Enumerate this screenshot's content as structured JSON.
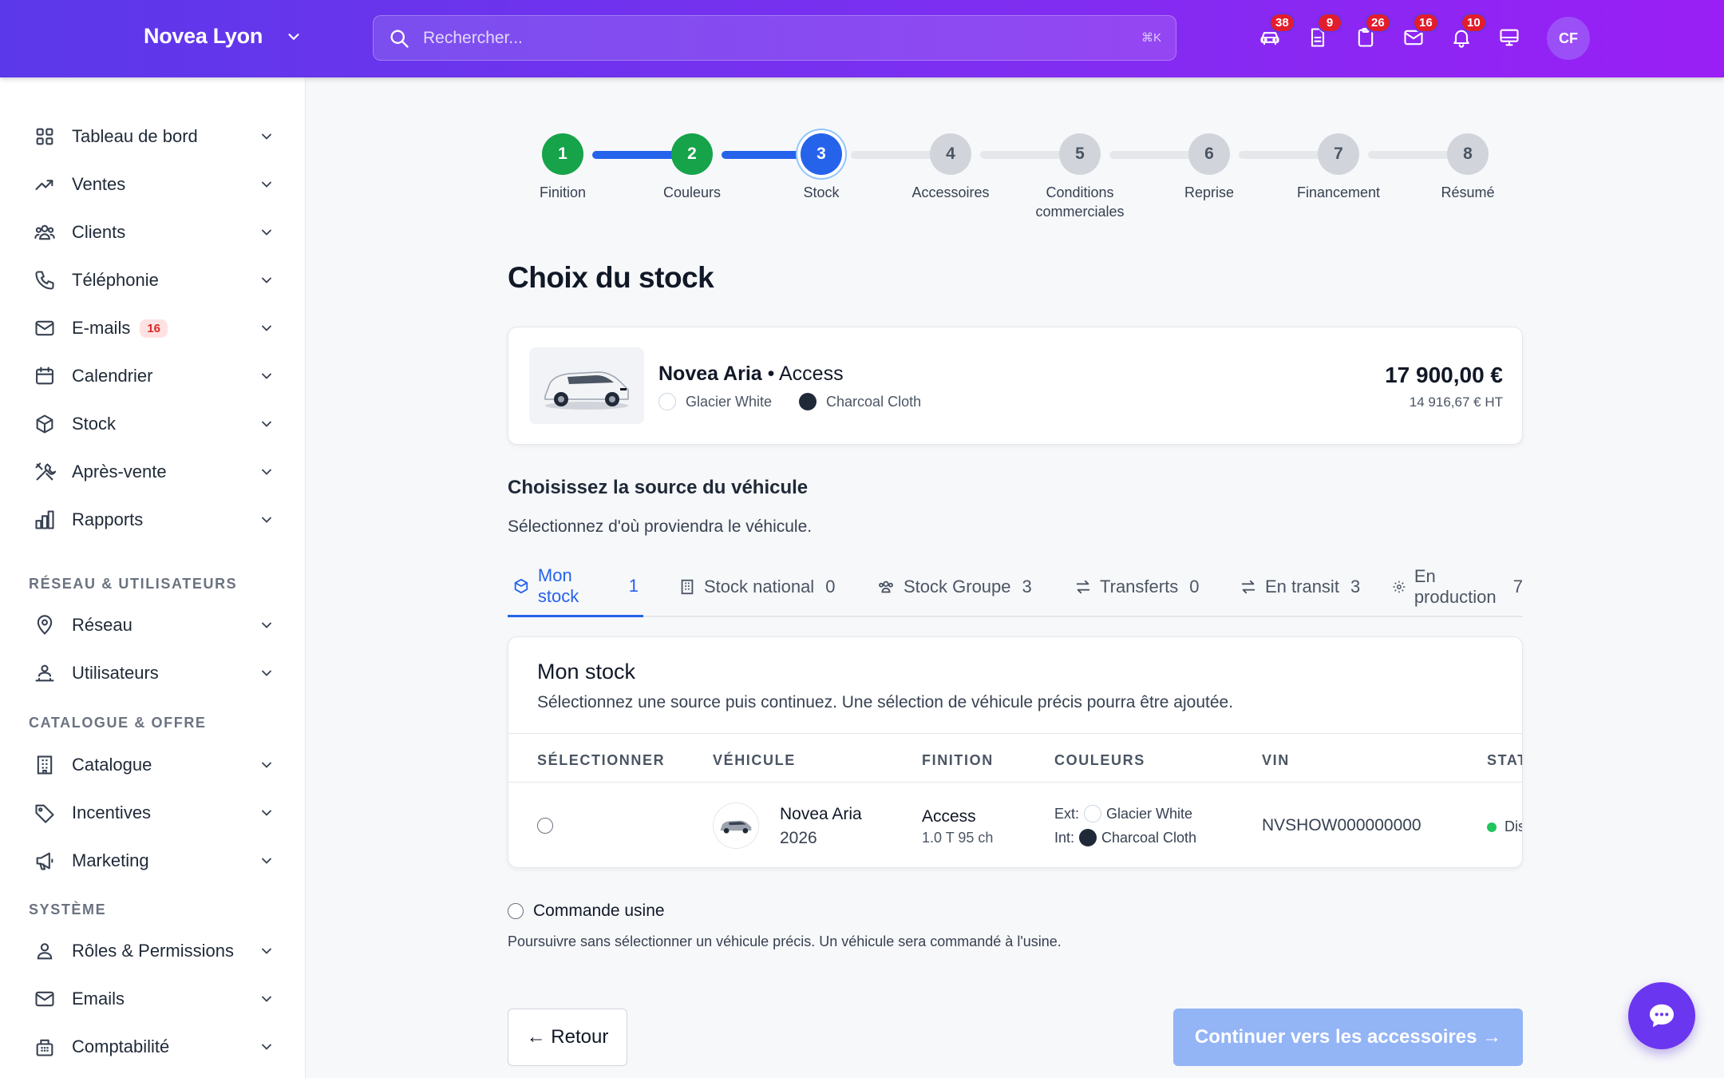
{
  "header": {
    "brand": "Novea Lyon",
    "search_placeholder": "Rechercher...",
    "shortcut": "⌘K",
    "icons": [
      {
        "name": "car-icon",
        "badge": "38"
      },
      {
        "name": "document-icon",
        "badge": "9"
      },
      {
        "name": "clipboard-icon",
        "badge": "26"
      },
      {
        "name": "mail-icon",
        "badge": "16"
      },
      {
        "name": "bell-icon",
        "badge": "10"
      },
      {
        "name": "monitor-icon",
        "badge": ""
      }
    ],
    "avatar": "CF"
  },
  "sidebar": {
    "items": [
      {
        "label": "Tableau de bord",
        "icon": "grid-icon"
      },
      {
        "label": "Ventes",
        "icon": "trending-icon"
      },
      {
        "label": "Clients",
        "icon": "users-icon"
      },
      {
        "label": "Téléphonie",
        "icon": "phone-icon"
      },
      {
        "label": "E-mails",
        "icon": "mail-icon",
        "count": "16"
      },
      {
        "label": "Calendrier",
        "icon": "calendar-icon"
      },
      {
        "label": "Stock",
        "icon": "box-icon"
      },
      {
        "label": "Après-vente",
        "icon": "tools-icon"
      },
      {
        "label": "Rapports",
        "icon": "chart-icon"
      }
    ],
    "section_network": "RÉSEAU & UTILISATEURS",
    "network_items": [
      {
        "label": "Réseau",
        "icon": "location-icon"
      },
      {
        "label": "Utilisateurs",
        "icon": "user-group-icon"
      }
    ],
    "section_catalog": "CATALOGUE & OFFRE",
    "catalog_items": [
      {
        "label": "Catalogue",
        "icon": "building-icon"
      },
      {
        "label": "Incentives",
        "icon": "tag-icon"
      },
      {
        "label": "Marketing",
        "icon": "megaphone-icon"
      }
    ],
    "section_system": "SYSTÈME",
    "system_items": [
      {
        "label": "Rôles & Permissions",
        "icon": "person-icon"
      },
      {
        "label": "Emails",
        "icon": "mail-icon"
      },
      {
        "label": "Comptabilité",
        "icon": "cash-register-icon"
      }
    ]
  },
  "stepper": {
    "steps": [
      {
        "n": "1",
        "label": "Finition",
        "state": "done"
      },
      {
        "n": "2",
        "label": "Couleurs",
        "state": "done"
      },
      {
        "n": "3",
        "label": "Stock",
        "state": "current"
      },
      {
        "n": "4",
        "label": "Accessoires",
        "state": "todo"
      },
      {
        "n": "5",
        "label": "Conditions commerciales",
        "state": "todo"
      },
      {
        "n": "6",
        "label": "Reprise",
        "state": "todo"
      },
      {
        "n": "7",
        "label": "Financement",
        "state": "todo"
      },
      {
        "n": "8",
        "label": "Résumé",
        "state": "todo"
      }
    ]
  },
  "page_title": "Choix du stock",
  "summary": {
    "model": "Novea Aria",
    "separator": "•",
    "trim": "Access",
    "ext_color": "Glacier White",
    "int_color": "Charcoal Cloth",
    "price": "17 900,00 €",
    "price_ht": "14 916,67 € HT"
  },
  "source": {
    "title": "Choisissez la source du véhicule",
    "subtitle": "Sélectionnez d'où proviendra le véhicule."
  },
  "tabs": [
    {
      "label": "Mon stock",
      "count": "1",
      "icon": "box-icon"
    },
    {
      "label": "Stock national",
      "count": "0",
      "icon": "building-icon"
    },
    {
      "label": "Stock Groupe",
      "count": "3",
      "icon": "users-icon"
    },
    {
      "label": "Transferts",
      "count": "0",
      "icon": "transfer-icon"
    },
    {
      "label": "En transit",
      "count": "3",
      "icon": "transfer-icon"
    },
    {
      "label": "En production",
      "count": "7",
      "icon": "gear-icon"
    }
  ],
  "stock_card": {
    "title": "Mon stock",
    "subtitle": "Sélectionnez une source puis continuez. Une sélection de véhicule précis pourra être ajoutée.",
    "columns": [
      "SÉLECTIONNER",
      "VÉHICULE",
      "FINITION",
      "COULEURS",
      "VIN",
      "STAT"
    ],
    "row": {
      "model": "Novea Aria",
      "year": "2026",
      "trim": "Access",
      "engine": "1.0 T 95 ch",
      "ext_label": "Ext:",
      "ext_color": "Glacier White",
      "int_label": "Int:",
      "int_color": "Charcoal Cloth",
      "vin": "NVSHOW000000000",
      "status": "Dis"
    }
  },
  "factory": {
    "label": "Commande usine",
    "help": "Poursuivre sans sélectionner un véhicule précis. Un véhicule sera commandé à l'usine."
  },
  "buttons": {
    "back": "← Retour",
    "next": "Continuer vers les accessoires →"
  },
  "colors": {
    "accent": "#2563eb",
    "success": "#16a34a",
    "header_start": "#5b38ea",
    "header_end": "#9a1ff5",
    "badge": "#e11d2e"
  }
}
